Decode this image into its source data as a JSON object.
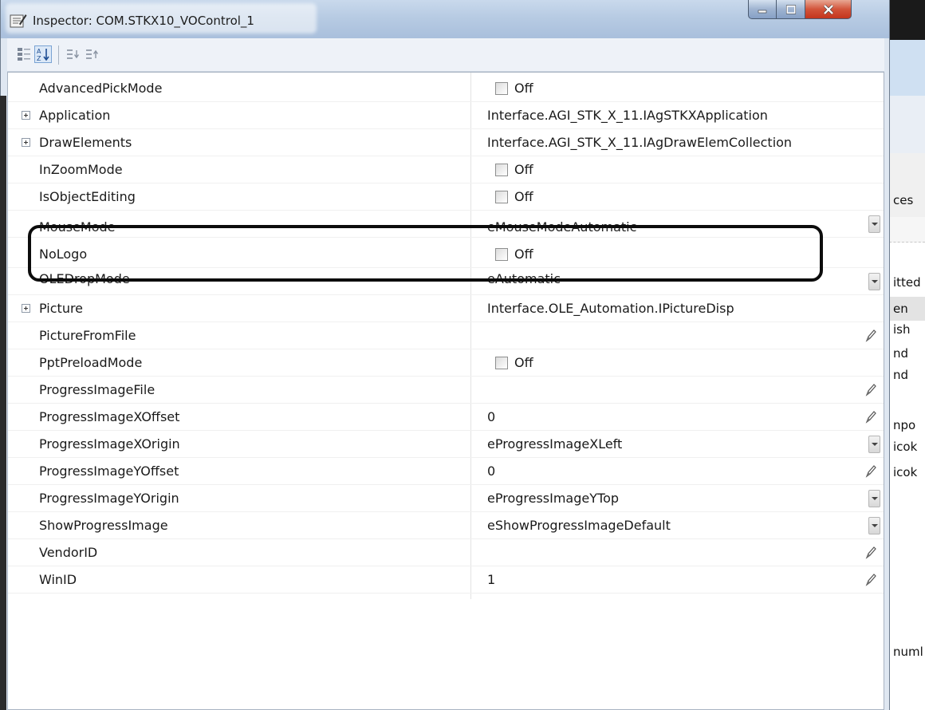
{
  "window": {
    "title": "Inspector: COM.STKX10_VOControl_1"
  },
  "toolbar": {
    "categorized_icon": "categorized-icon",
    "alphabetical_icon": "alphabetical-sort-icon",
    "expand_icon": "expand-all-icon",
    "collapse_icon": "collapse-all-icon"
  },
  "properties": [
    {
      "name": "AdvancedPickMode",
      "value": "Off"
    },
    {
      "name": "Application",
      "value": "Interface.AGI_STK_X_11.IAgSTKXApplication"
    },
    {
      "name": "DrawElements",
      "value": "Interface.AGI_STK_X_11.IAgDrawElemCollection"
    },
    {
      "name": "InZoomMode",
      "value": "Off"
    },
    {
      "name": "IsObjectEditing",
      "value": "Off"
    },
    {
      "name": "MouseMode",
      "value": "eMouseModeAutomatic"
    },
    {
      "name": "NoLogo",
      "value": "Off"
    },
    {
      "name": "OLEDropMode",
      "value": "eAutomatic"
    },
    {
      "name": "Picture",
      "value": "Interface.OLE_Automation.IPictureDisp"
    },
    {
      "name": "PictureFromFile",
      "value": ""
    },
    {
      "name": "PptPreloadMode",
      "value": "Off"
    },
    {
      "name": "ProgressImageFile",
      "value": ""
    },
    {
      "name": "ProgressImageXOffset",
      "value": "0"
    },
    {
      "name": "ProgressImageXOrigin",
      "value": "eProgressImageXLeft"
    },
    {
      "name": "ProgressImageYOffset",
      "value": "0"
    },
    {
      "name": "ProgressImageYOrigin",
      "value": "eProgressImageYTop"
    },
    {
      "name": "ShowProgressImage",
      "value": "eShowProgressImageDefault"
    },
    {
      "name": "VendorID",
      "value": ""
    },
    {
      "name": "WinID",
      "value": "1"
    }
  ],
  "background_app": {
    "texts": [
      "ces",
      "itted",
      "en",
      "ish",
      "nd",
      "nd",
      "npo",
      "icok",
      "icok",
      "numl"
    ]
  }
}
